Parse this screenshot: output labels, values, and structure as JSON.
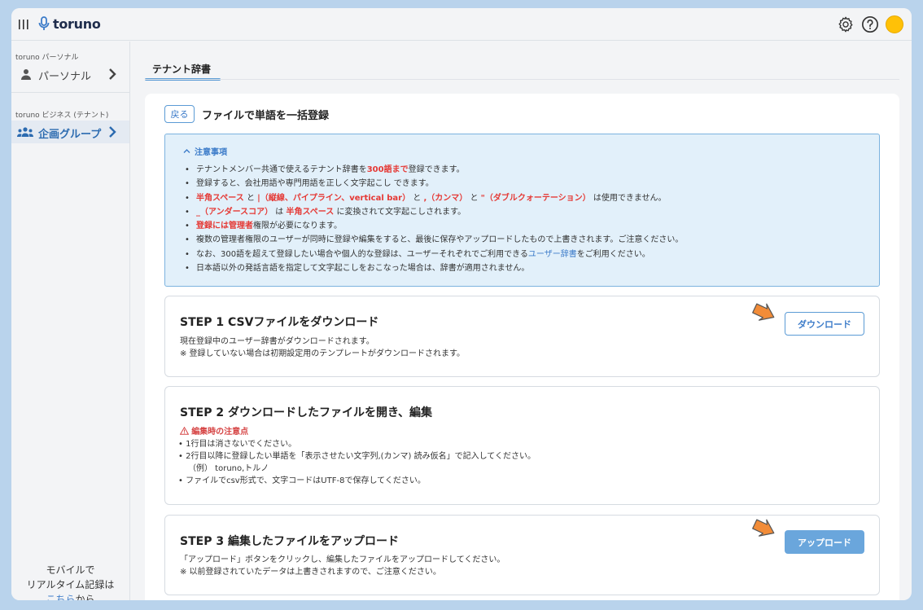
{
  "app": {
    "logo_text": "toruno"
  },
  "sidebar": {
    "personal_section": "toruno パーソナル",
    "personal_item": "パーソナル",
    "business_section": "toruno ビジネス (テナント)",
    "business_item": "企画グループ",
    "mobile_line1": "モバイルで",
    "mobile_line2": "リアルタイム記録は",
    "mobile_link": "こちら",
    "mobile_suffix": "から"
  },
  "tab": {
    "label": "テナント辞書"
  },
  "page": {
    "back_label": "戻る",
    "title": "ファイルで単語を一括登録"
  },
  "notice": {
    "header": "注意事項",
    "items": [
      [
        {
          "t": "テナントメンバー共通で使えるテナント辞書を"
        },
        {
          "t": "300語まで",
          "s": "red"
        },
        {
          "t": "登録できます。"
        }
      ],
      [
        {
          "t": "登録すると、会社用語や専門用語を正しく文字起こし できます。"
        }
      ],
      [
        {
          "t": "半角スペース",
          "s": "red"
        },
        {
          "t": " と "
        },
        {
          "t": "|（縦線、パイプライン、vertical bar）",
          "s": "red"
        },
        {
          "t": " と "
        },
        {
          "t": ",（カンマ）",
          "s": "red"
        },
        {
          "t": " と "
        },
        {
          "t": "\"（ダブルクォーテーション）",
          "s": "red"
        },
        {
          "t": " は使用できません。"
        }
      ],
      [
        {
          "t": "_（アンダースコア）",
          "s": "red"
        },
        {
          "t": " は "
        },
        {
          "t": "半角スペース",
          "s": "red"
        },
        {
          "t": " に変換されて文字起こしされます。"
        }
      ],
      [
        {
          "t": "登録には管理者",
          "s": "red"
        },
        {
          "t": "権限が必要になります。"
        }
      ],
      [
        {
          "t": "複数の管理者権限のユーザーが同時に登録や編集をすると、最後に保存やアップロードしたもので上書きされます。ご注意ください。"
        }
      ],
      [
        {
          "t": "なお、300語を超えて登録したい場合や個人的な登録は、ユーザーそれぞれでご利用できる"
        },
        {
          "t": "ユーザー辞書",
          "s": "blue"
        },
        {
          "t": "をご利用ください。"
        }
      ],
      [
        {
          "t": "日本語以外の発話言語を指定して文字起こしをおこなった場合は、辞書が適用されません。"
        }
      ]
    ]
  },
  "step1": {
    "title": "STEP 1 CSVファイルをダウンロード",
    "line1": "現在登録中のユーザー辞書がダウンロードされます。",
    "line2": "※ 登録していない場合は初期設定用のテンプレートがダウンロードされます。",
    "button": "ダウンロード"
  },
  "step2": {
    "title": "STEP 2 ダウンロードしたファイルを開き、編集",
    "warn": "編集時の注意点",
    "line1": "• 1行目は消さないでください。",
    "line2": "• 2行目以降に登録したい単語を「表示させたい文字列,(カンマ) 読み仮名」で記入してください。",
    "line3": "（例） toruno,トルノ",
    "line4": "• ファイルでcsv形式で、文字コードはUTF-8で保存してください。"
  },
  "step3": {
    "title": "STEP 3 編集したファイルをアップロード",
    "line1": "「アップロード」ボタンをクリックし、編集したファイルをアップロードしてください。",
    "line2": "※ 以前登録されていたデータは上書きされますので、ご注意ください。",
    "button": "アップロード"
  },
  "colors": {
    "accent": "#3d7cc9",
    "warning": "#e53935",
    "arrow": "#f28c38",
    "avatar": "#ffc107"
  }
}
